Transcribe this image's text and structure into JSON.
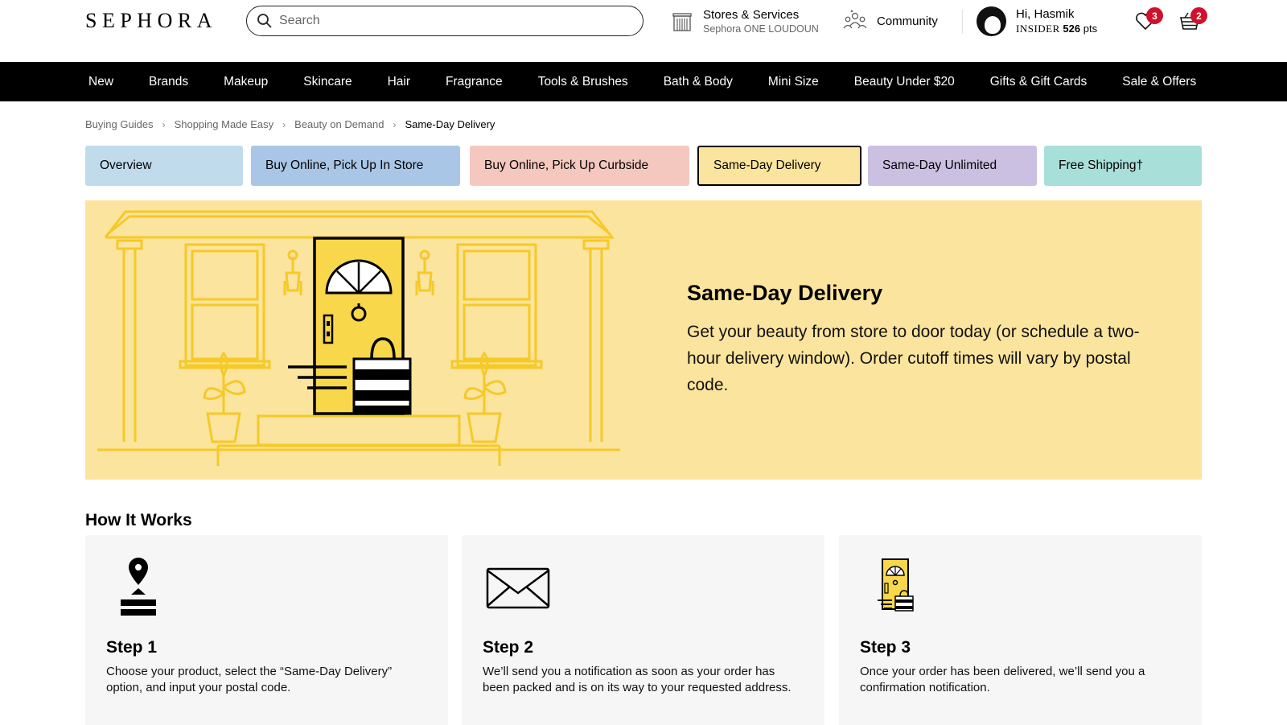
{
  "header": {
    "logo": "SEPHORA",
    "search_placeholder": "Search",
    "stores_title": "Stores & Services",
    "stores_location": "Sephora ONE LOUDOUN",
    "community": "Community",
    "greeting": "Hi, Hasmik",
    "tier": "INSIDER",
    "points": "526",
    "points_unit": "pts",
    "loves_count": "3",
    "basket_count": "2"
  },
  "nav": [
    "New",
    "Brands",
    "Makeup",
    "Skincare",
    "Hair",
    "Fragrance",
    "Tools & Brushes",
    "Bath & Body",
    "Mini Size",
    "Beauty Under $20",
    "Gifts & Gift Cards",
    "Sale & Offers"
  ],
  "breadcrumb": [
    "Buying Guides",
    "Shopping Made Easy",
    "Beauty on Demand",
    "Same-Day Delivery"
  ],
  "tabs": [
    {
      "label": "Overview",
      "color": "#c0dcec"
    },
    {
      "label": "Buy Online, Pick Up In Store",
      "color": "#a9c6e6"
    },
    {
      "label": "Buy Online, Pick Up Curbside",
      "color": "#f4c8bf"
    },
    {
      "label": "Same-Day Delivery",
      "color": "#fbe49d"
    },
    {
      "label": "Same-Day Unlimited",
      "color": "#cbbfe2"
    },
    {
      "label": "Free Shipping†",
      "color": "#a9dfd9"
    }
  ],
  "hero": {
    "title": "Same-Day Delivery",
    "body": "Get your beauty from store to door today (or schedule a two-hour delivery window). Order cutoff times will vary by postal code.",
    "background": "#fbe49d"
  },
  "how_it_works": {
    "title": "How It Works",
    "steps": [
      {
        "title": "Step 1",
        "body": "Choose your product, select the “Same-Day Delivery” option, and input your postal code.",
        "icon": "location-pin-icon"
      },
      {
        "title": "Step 2",
        "body": "We’ll send you a notification as soon as your order has been packed and is on its way to your requested address.",
        "icon": "envelope-icon"
      },
      {
        "title": "Step 3",
        "body": "Once your order has been delivered, we’ll send you a confirmation notification.",
        "icon": "door-delivery-icon"
      }
    ]
  },
  "colors": {
    "accent": "#cf112c",
    "nav_bg": "#000000",
    "step_bg": "#f6f6f6"
  }
}
